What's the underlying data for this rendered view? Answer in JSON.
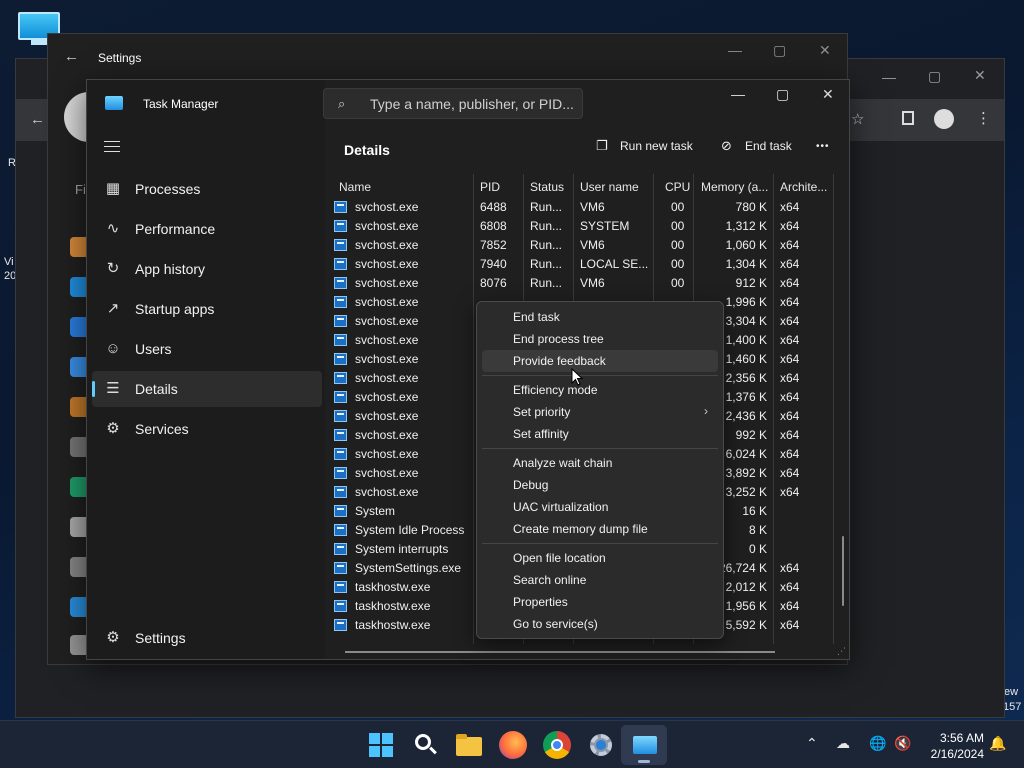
{
  "desktop": {
    "edge_left": [
      "R",
      "Vi",
      "20"
    ],
    "edge_right": [
      "ew",
      "157"
    ]
  },
  "settings_window": {
    "title": "Settings",
    "search_partial": "Fi"
  },
  "task_manager": {
    "title": "Task Manager",
    "search": {
      "placeholder": "Type a name, publisher, or PID..."
    },
    "nav": {
      "items": [
        {
          "label": "Processes",
          "icon": "processes-icon"
        },
        {
          "label": "Performance",
          "icon": "performance-icon"
        },
        {
          "label": "App history",
          "icon": "app-history-icon"
        },
        {
          "label": "Startup apps",
          "icon": "startup-icon"
        },
        {
          "label": "Users",
          "icon": "users-icon"
        },
        {
          "label": "Details",
          "icon": "details-icon",
          "selected": true
        },
        {
          "label": "Services",
          "icon": "services-icon"
        }
      ],
      "settings_label": "Settings"
    },
    "page": {
      "title": "Details",
      "run_new_task": "Run new task",
      "end_task": "End task",
      "more": "•••"
    },
    "columns": [
      "Name",
      "PID",
      "Status",
      "User name",
      "CPU",
      "Memory (a...",
      "Archite..."
    ],
    "rows": [
      {
        "name": "svchost.exe",
        "pid": "6488",
        "status": "Run...",
        "user": "VM6",
        "cpu": "00",
        "mem": "780 K",
        "arch": "x64"
      },
      {
        "name": "svchost.exe",
        "pid": "6808",
        "status": "Run...",
        "user": "SYSTEM",
        "cpu": "00",
        "mem": "1,312 K",
        "arch": "x64"
      },
      {
        "name": "svchost.exe",
        "pid": "7852",
        "status": "Run...",
        "user": "VM6",
        "cpu": "00",
        "mem": "1,060 K",
        "arch": "x64"
      },
      {
        "name": "svchost.exe",
        "pid": "7940",
        "status": "Run...",
        "user": "LOCAL SE...",
        "cpu": "00",
        "mem": "1,304 K",
        "arch": "x64"
      },
      {
        "name": "svchost.exe",
        "pid": "8076",
        "status": "Run...",
        "user": "VM6",
        "cpu": "00",
        "mem": "912 K",
        "arch": "x64"
      },
      {
        "name": "svchost.exe",
        "pid": "",
        "status": "",
        "user": "",
        "cpu": "",
        "mem": "1,996 K",
        "arch": "x64"
      },
      {
        "name": "svchost.exe",
        "pid": "",
        "status": "",
        "user": "",
        "cpu": "",
        "mem": "3,304 K",
        "arch": "x64"
      },
      {
        "name": "svchost.exe",
        "pid": "",
        "status": "",
        "user": "",
        "cpu": "",
        "mem": "1,400 K",
        "arch": "x64"
      },
      {
        "name": "svchost.exe",
        "pid": "",
        "status": "",
        "user": "",
        "cpu": "",
        "mem": "1,460 K",
        "arch": "x64"
      },
      {
        "name": "svchost.exe",
        "pid": "",
        "status": "",
        "user": "",
        "cpu": "",
        "mem": "2,356 K",
        "arch": "x64"
      },
      {
        "name": "svchost.exe",
        "pid": "",
        "status": "",
        "user": "",
        "cpu": "",
        "mem": "1,376 K",
        "arch": "x64"
      },
      {
        "name": "svchost.exe",
        "pid": "",
        "status": "",
        "user": "",
        "cpu": "",
        "mem": "2,436 K",
        "arch": "x64"
      },
      {
        "name": "svchost.exe",
        "pid": "",
        "status": "",
        "user": "",
        "cpu": "",
        "mem": "992 K",
        "arch": "x64"
      },
      {
        "name": "svchost.exe",
        "pid": "",
        "status": "",
        "user": "",
        "cpu": "",
        "mem": "6,024 K",
        "arch": "x64"
      },
      {
        "name": "svchost.exe",
        "pid": "",
        "status": "",
        "user": "",
        "cpu": "",
        "mem": "3,892 K",
        "arch": "x64"
      },
      {
        "name": "svchost.exe",
        "pid": "",
        "status": "",
        "user": "",
        "cpu": "",
        "mem": "3,252 K",
        "arch": "x64"
      },
      {
        "name": "System",
        "pid": "",
        "status": "",
        "user": "",
        "cpu": "",
        "mem": "16 K",
        "arch": ""
      },
      {
        "name": "System Idle Process",
        "pid": "",
        "status": "",
        "user": "",
        "cpu": "",
        "mem": "8 K",
        "arch": ""
      },
      {
        "name": "System interrupts",
        "pid": "",
        "status": "",
        "user": "",
        "cpu": "",
        "mem": "0 K",
        "arch": ""
      },
      {
        "name": "SystemSettings.exe",
        "pid": "",
        "status": "",
        "user": "",
        "cpu": "",
        "mem": "26,724 K",
        "arch": "x64"
      },
      {
        "name": "taskhostw.exe",
        "pid": "",
        "status": "",
        "user": "",
        "cpu": "",
        "mem": "2,012 K",
        "arch": "x64"
      },
      {
        "name": "taskhostw.exe",
        "pid": "",
        "status": "",
        "user": "",
        "cpu": "",
        "mem": "1,956 K",
        "arch": "x64"
      },
      {
        "name": "taskhostw.exe",
        "pid": "",
        "status": "",
        "user": "",
        "cpu": "",
        "mem": "5,592 K",
        "arch": "x64"
      }
    ]
  },
  "context_menu": {
    "items": [
      "End task",
      "End process tree",
      "Provide feedback",
      "---",
      "Efficiency mode",
      "Set priority",
      "Set affinity",
      "---",
      "Analyze wait chain",
      "Debug",
      "UAC virtualization",
      "Create memory dump file",
      "---",
      "Open file location",
      "Search online",
      "Properties",
      "Go to service(s)"
    ],
    "hovered": "Provide feedback",
    "submenu": "Set priority"
  },
  "taskbar": {
    "time": "3:56 AM",
    "date": "2/16/2024",
    "apps": [
      "start-icon",
      "search-icon",
      "file-explorer-icon",
      "firefox-icon",
      "chrome-icon",
      "settings-icon",
      "task-manager-icon"
    ]
  },
  "colors": {
    "accent": "#60cdff",
    "window_bg": "#1f1f1f",
    "menu_bg": "#2b2b2b"
  }
}
